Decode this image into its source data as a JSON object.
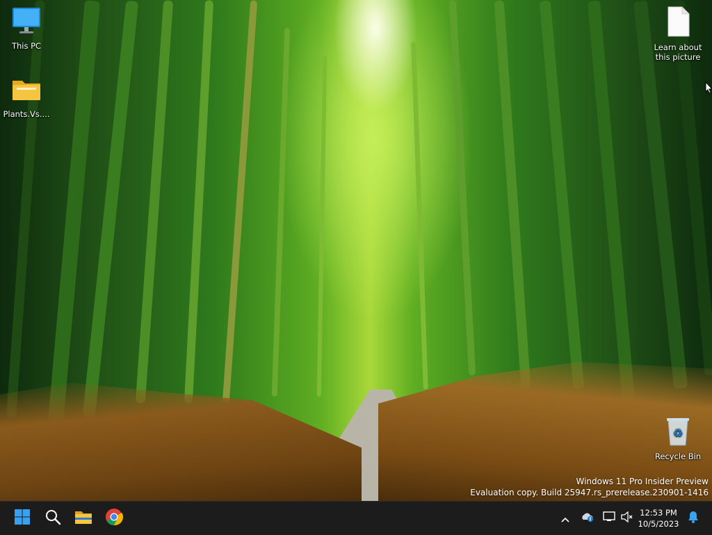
{
  "desktop": {
    "icons": [
      {
        "label": "This PC",
        "icon": "monitor-icon"
      },
      {
        "label": "Plants.Vs....",
        "icon": "folder-icon"
      },
      {
        "label": "Learn about this picture",
        "icon": "document-icon"
      },
      {
        "label": "Recycle Bin",
        "icon": "recycle-bin-icon"
      }
    ],
    "watermark": {
      "line1": "Windows 11 Pro Insider Preview",
      "line2": "Evaluation copy. Build 25947.rs_prerelease.230901-1416"
    }
  },
  "taskbar": {
    "pinned": [
      {
        "icon": "windows-start-icon"
      },
      {
        "icon": "search-icon"
      },
      {
        "icon": "file-explorer-icon"
      },
      {
        "icon": "chrome-icon"
      }
    ],
    "tray": {
      "icons": [
        "chevron-up-icon",
        "onedrive-icon",
        "network-icon",
        "speaker-muted-icon",
        "notification-bell-icon"
      ]
    },
    "clock": {
      "time": "12:53 PM",
      "date": "10/5/2023"
    }
  },
  "colors": {
    "taskbar_bg": "#1c1c1c",
    "start_blue": "#3aa0f0",
    "folder_yellow": "#f5c542"
  }
}
